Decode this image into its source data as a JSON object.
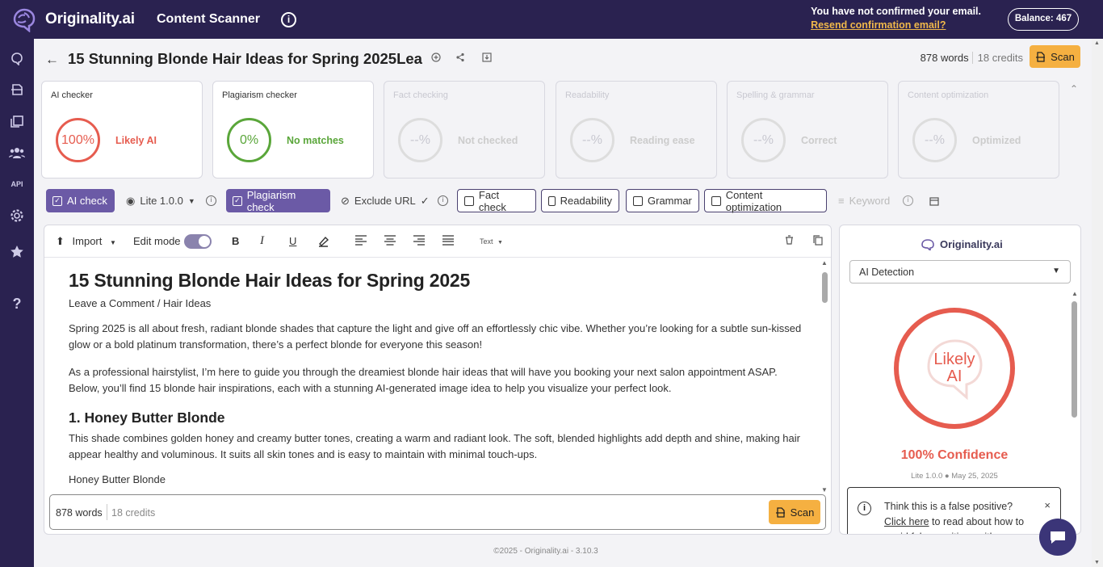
{
  "topbar": {
    "brand": "Originality.ai",
    "app_title": "Content Scanner",
    "info_glyph": "i",
    "email_notice": "You have not confirmed your email.",
    "resend_link": "Resend confirmation email?",
    "balance": "Balance: 467"
  },
  "sidebar": {
    "api_label": "API",
    "help_glyph": "?"
  },
  "doc": {
    "title": "15 Stunning Blonde Hair Ideas for Spring 2025Lea",
    "words": "878 words",
    "credits": "18 credits",
    "scan_label": "Scan"
  },
  "cards": [
    {
      "title": "AI checker",
      "value": "100%",
      "status": "Likely AI",
      "color": "#e65c4f"
    },
    {
      "title": "Plagiarism checker",
      "value": "0%",
      "status": "No matches",
      "color": "#5aa63a"
    },
    {
      "title": "Fact checking",
      "value": "--%",
      "status": "Not checked"
    },
    {
      "title": "Readability",
      "value": "--%",
      "status": "Reading ease"
    },
    {
      "title": "Spelling & grammar",
      "value": "--%",
      "status": "Correct"
    },
    {
      "title": "Content optimization",
      "value": "--%",
      "status": "Optimized"
    }
  ],
  "toolbar": {
    "ai_check": "AI check",
    "model": "Lite 1.0.0",
    "plagiarism_check": "Plagiarism check",
    "exclude_url": "Exclude URL",
    "fact_check": "Fact check",
    "readability": "Readability",
    "grammar": "Grammar",
    "content_optimization": "Content optimization",
    "keyword": "Keyword"
  },
  "editor": {
    "import": "Import",
    "edit_mode": "Edit mode",
    "text_style": "Text",
    "h1": "15 Stunning Blonde Hair Ideas for Spring 2025",
    "meta": "Leave a Comment / Hair Ideas",
    "p1": "Spring 2025 is all about fresh, radiant blonde shades that capture the light and give off an effortlessly chic vibe. Whether you’re looking for a subtle sun-kissed glow or a bold platinum transformation, there’s a perfect blonde for everyone this season!",
    "p2": "As a professional hairstylist, I’m here to guide you through the dreamiest blonde hair ideas that will have you booking your next salon appointment ASAP. Below, you’ll find 15 blonde hair inspirations, each with a stunning AI-generated image idea to help you visualize your perfect look.",
    "h2": "1. Honey Butter Blonde",
    "p3": "This shade combines golden honey and creamy butter tones, creating a warm and radiant look. The soft, blended highlights add depth and shine, making hair appear healthy and voluminous. It suits all skin tones and is easy to maintain with minimal touch-ups.",
    "p4": "Honey Butter Blonde",
    "footer_words": "878 words",
    "footer_credits": "18 credits",
    "footer_scan": "Scan"
  },
  "panel": {
    "brand": "Originality.ai",
    "select_value": "AI Detection",
    "ring_line1": "Likely",
    "ring_line2": "AI",
    "confidence": "100% Confidence",
    "version": "Lite 1.0.0",
    "date": "May 25, 2025",
    "fp_line1": "Think this is a false positive?",
    "fp_link": "Click here",
    "fp_rest": " to read about how to avoid false positives with our",
    "close": "×"
  },
  "footer": {
    "copyright": "©2025 - Originality.ai - 3.10.3"
  },
  "colors": {
    "nav": "#2a2250",
    "accent": "#6b5aa6",
    "scan": "#f5b041",
    "ai_red": "#e65c4f",
    "green": "#5aa63a"
  }
}
